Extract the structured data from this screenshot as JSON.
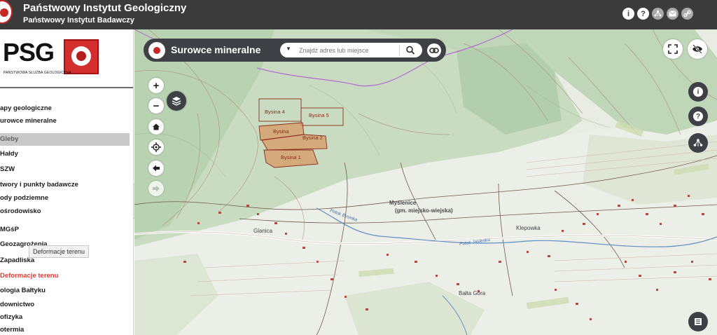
{
  "header": {
    "title": "Państwowy Instytut Geologiczny",
    "subtitle": "Państwowy Instytut Badawczy",
    "icons": [
      "info-icon",
      "help-icon",
      "share-network-icon",
      "mail-icon",
      "link-icon"
    ],
    "bg_color": "#3b3b3b"
  },
  "sidebar": {
    "logo_text": "PSG",
    "logo_subtext": "PAŃSTWOWA SŁUŻBA GEOLOGICZNA",
    "items": [
      {
        "label": "apy geologiczne"
      },
      {
        "label": "urowce mineralne"
      },
      {
        "label": "Gleby"
      },
      {
        "label": "Hałdy"
      },
      {
        "label": "SZW"
      },
      {
        "label": "twory i punkty badawcze"
      },
      {
        "label": "ody podziemne"
      },
      {
        "label": "ośrodowisko"
      },
      {
        "label": "MGśP"
      },
      {
        "label": "Geozagrożenia"
      },
      {
        "label": "Zapadliska"
      },
      {
        "label": "Deformacje terenu"
      },
      {
        "label": "ologia Bałtyku"
      },
      {
        "label": "downictwo"
      },
      {
        "label": "ofizyka"
      },
      {
        "label": "otermia"
      }
    ],
    "tooltip": "Deformacje terenu",
    "accent_red": "#e53935"
  },
  "searchbar": {
    "title": "Surowce mineralne",
    "placeholder": "Znajdź adres lub miejsce"
  },
  "map": {
    "claims": [
      "Bysina 4",
      "Bysina 5",
      "Bysina",
      "Bysina 2",
      "Bysina 1"
    ],
    "places": [
      "Myślenice",
      "(gm. miejsko-wiejska)",
      "Glanica",
      "Klepowka",
      "Bałta Góra"
    ],
    "rivers": [
      "Potok Bysinka",
      "Potok Jasienka"
    ],
    "zoom_in": "+",
    "zoom_out": "−"
  }
}
